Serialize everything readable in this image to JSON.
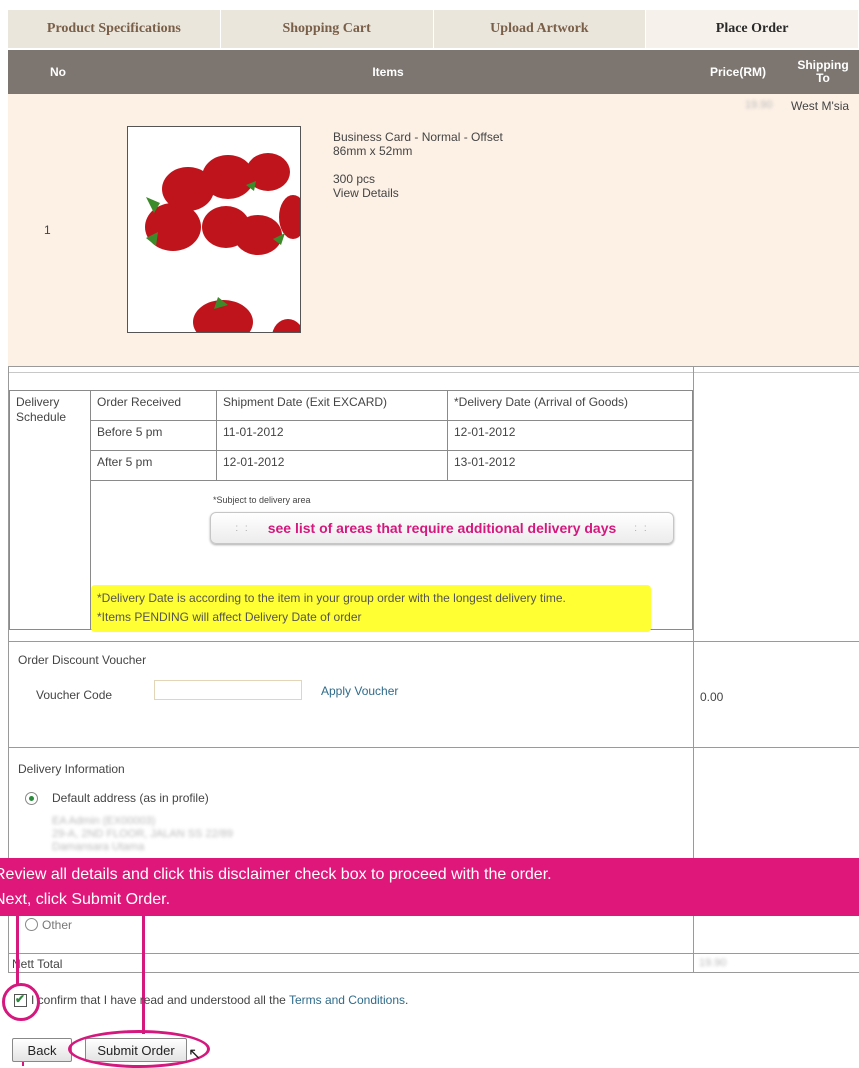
{
  "tabs": [
    {
      "label": "Product Specifications"
    },
    {
      "label": "Shopping Cart"
    },
    {
      "label": "Upload Artwork"
    },
    {
      "label": "Place Order"
    }
  ],
  "table_header": {
    "no": "No",
    "items": "Items",
    "price": "Price(RM)",
    "shipping_to": "Shipping To"
  },
  "item": {
    "no": "1",
    "name": "Business Card - Normal  -  Offset",
    "size": "86mm x 52mm",
    "quantity": "300 pcs",
    "details_link": "View Details",
    "price": "19.90",
    "shipping_to": "West M'sia",
    "thumbnail_icon": "strawberry-artwork-thumbnail"
  },
  "delivery_schedule": {
    "label": "Delivery Schedule",
    "headers": [
      "Order Received",
      "Shipment Date (Exit EXCARD)",
      "*Delivery Date (Arrival of Goods)"
    ],
    "rows": [
      [
        "Before 5 pm",
        "11-01-2012",
        "12-01-2012"
      ],
      [
        "After 5 pm",
        "12-01-2012",
        "13-01-2012"
      ]
    ],
    "subject_note": "*Subject to delivery area",
    "areas_button": "see list of areas that require additional delivery days",
    "note_line1": "*Delivery Date is according to the item in your group order with the longest delivery time.",
    "note_line2": "*Items PENDING will affect Delivery Date of order"
  },
  "voucher": {
    "section_label": "Order Discount Voucher",
    "code_label": "Voucher Code",
    "input_value": "",
    "apply_label": "Apply Voucher",
    "amount": "0.00"
  },
  "delivery_info": {
    "section_label": "Delivery Information",
    "default_option": "Default address (as in profile)",
    "address_line1": "EA Admin (EX00003)",
    "address_line2": "29-A, 2ND FLOOR, JALAN SS 22/89",
    "address_line3": "Damansara Utama",
    "other_option": "Other"
  },
  "nett_total": {
    "label": "Nett Total",
    "value": "19.90"
  },
  "confirm": {
    "text": "I confirm that I have read and understood all the ",
    "terms_link": "Terms and Conditions",
    "suffix": ".",
    "checked": true
  },
  "buttons": {
    "back": "Back",
    "submit": "Submit Order"
  },
  "callout": {
    "line1": "Review all details and click this disclaimer check box to proceed with the order.",
    "line2": "Next, click Submit Order."
  },
  "colors": {
    "accent": "#e0177a",
    "header": "#7d7670",
    "item_bg": "#fdf1e6",
    "highlight": "#ffff33"
  }
}
